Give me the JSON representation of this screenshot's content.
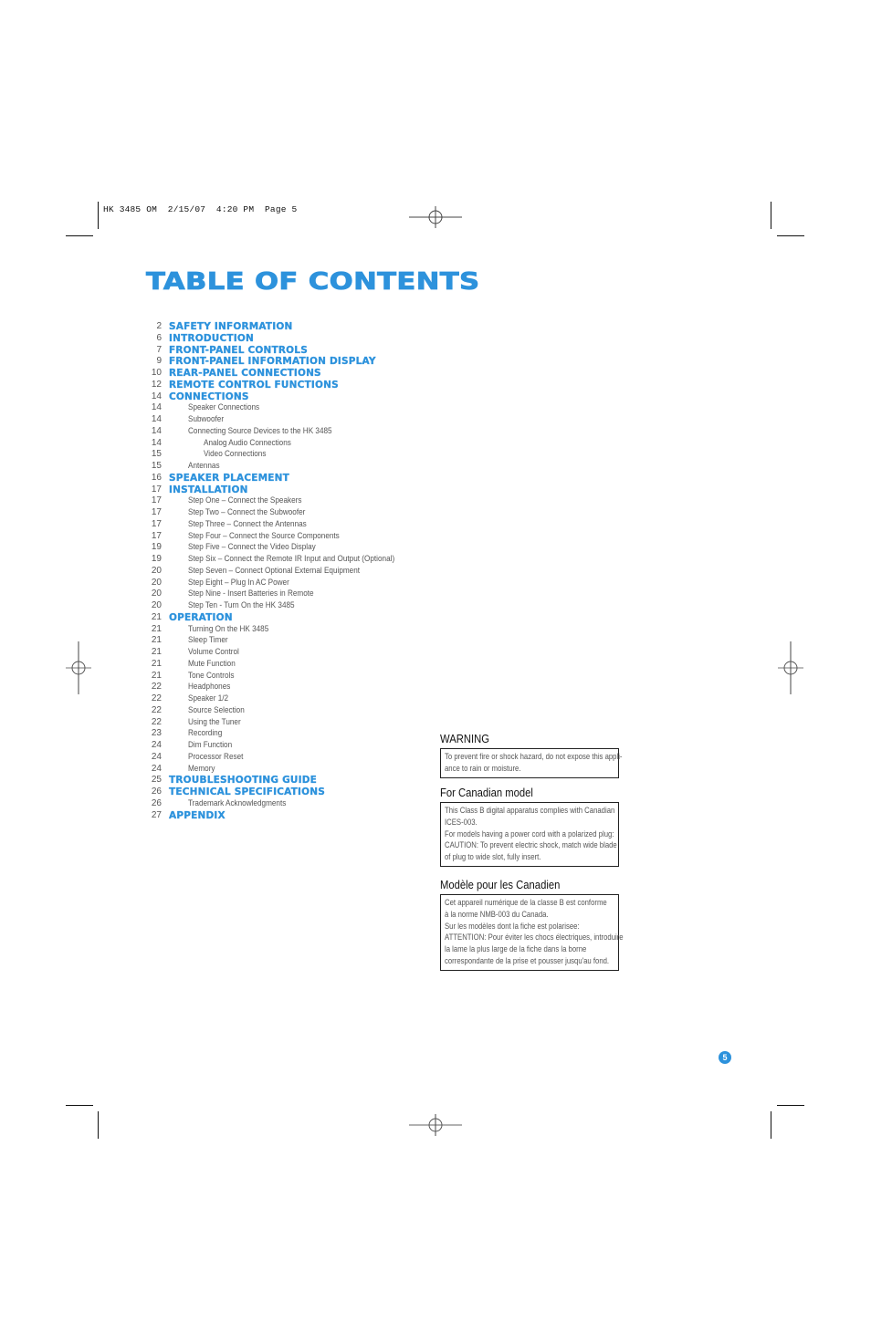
{
  "print_slug": "HK 3485 OM  2/15/07  4:20 PM  Page 5",
  "title": "TABLE OF CONTENTS",
  "accent_color": "#2d92dc",
  "toc": [
    {
      "page": "2",
      "label": "SAFETY INFORMATION",
      "level": 0
    },
    {
      "page": "6",
      "label": "INTRODUCTION",
      "level": 0
    },
    {
      "page": "7",
      "label": "FRONT-PANEL CONTROLS",
      "level": 0
    },
    {
      "page": "9",
      "label": "FRONT-PANEL INFORMATION DISPLAY",
      "level": 0
    },
    {
      "page": "10",
      "label": "REAR-PANEL CONNECTIONS",
      "level": 0
    },
    {
      "page": "12",
      "label": "REMOTE CONTROL FUNCTIONS",
      "level": 0
    },
    {
      "page": "14",
      "label": "CONNECTIONS",
      "level": 0
    },
    {
      "page": "14",
      "label": "Speaker Connections",
      "level": 1
    },
    {
      "page": "14",
      "label": "Subwoofer",
      "level": 1
    },
    {
      "page": "14",
      "label": "Connecting Source Devices to the HK 3485",
      "level": 1
    },
    {
      "page": "14",
      "label": "Analog Audio Connections",
      "level": 2
    },
    {
      "page": "15",
      "label": "Video Connections",
      "level": 2
    },
    {
      "page": "15",
      "label": "Antennas",
      "level": 1
    },
    {
      "page": "16",
      "label": "SPEAKER PLACEMENT",
      "level": 0
    },
    {
      "page": "17",
      "label": "INSTALLATION",
      "level": 0
    },
    {
      "page": "17",
      "label": "Step One – Connect the Speakers",
      "level": 1
    },
    {
      "page": "17",
      "label": "Step Two – Connect the Subwoofer",
      "level": 1
    },
    {
      "page": "17",
      "label": "Step Three – Connect the Antennas",
      "level": 1
    },
    {
      "page": "17",
      "label": "Step Four – Connect the Source Components",
      "level": 1
    },
    {
      "page": "19",
      "label": "Step Five – Connect the Video Display",
      "level": 1
    },
    {
      "page": "19",
      "label": "Step Six – Connect the Remote IR Input and Output (Optional)",
      "level": 1
    },
    {
      "page": "20",
      "label": "Step Seven – Connect Optional External Equipment",
      "level": 1
    },
    {
      "page": "20",
      "label": "Step Eight – Plug In AC Power",
      "level": 1
    },
    {
      "page": "20",
      "label": "Step Nine - Insert Batteries in Remote",
      "level": 1
    },
    {
      "page": "20",
      "label": "Step Ten - Turn On the HK 3485",
      "level": 1
    },
    {
      "page": "21",
      "label": "OPERATION",
      "level": 0
    },
    {
      "page": "21",
      "label": "Turning On the HK 3485",
      "level": 1
    },
    {
      "page": "21",
      "label": "Sleep Timer",
      "level": 1
    },
    {
      "page": "21",
      "label": "Volume Control",
      "level": 1
    },
    {
      "page": "21",
      "label": "Mute Function",
      "level": 1
    },
    {
      "page": "21",
      "label": "Tone Controls",
      "level": 1
    },
    {
      "page": "22",
      "label": "Headphones",
      "level": 1
    },
    {
      "page": "22",
      "label": "Speaker 1/2",
      "level": 1
    },
    {
      "page": "22",
      "label": "Source Selection",
      "level": 1
    },
    {
      "page": "22",
      "label": "Using the Tuner",
      "level": 1
    },
    {
      "page": "23",
      "label": "Recording",
      "level": 1
    },
    {
      "page": "24",
      "label": "Dim Function",
      "level": 1
    },
    {
      "page": "24",
      "label": "Processor Reset",
      "level": 1
    },
    {
      "page": "24",
      "label": "Memory",
      "level": 1
    },
    {
      "page": "25",
      "label": "TROUBLESHOOTING GUIDE",
      "level": 0
    },
    {
      "page": "26",
      "label": "TECHNICAL SPECIFICATIONS",
      "level": 0
    },
    {
      "page": "26",
      "label": "Trademark Acknowledgments",
      "level": 1
    },
    {
      "page": "27",
      "label": "APPENDIX",
      "level": 0
    }
  ],
  "notices": [
    {
      "heading": "WARNING",
      "lines": [
        "To prevent fire or shock hazard, do not expose this appli-",
        "ance to rain or moisture."
      ]
    },
    {
      "heading": "For Canadian model",
      "lines": [
        "This Class B digital apparatus complies with Canadian",
        "ICES-003.",
        "For models having a power cord with a polarized plug:",
        "CAUTION: To prevent electric shock, match wide blade",
        "of plug to wide slot, fully insert."
      ]
    },
    {
      "heading": "Modèle pour les Canadien",
      "lines": [
        "Cet appareil numérique de la classe B est conforme",
        "à la norme NMB-003 du Canada.",
        "Sur les modèles dont la fiche est polarisee:",
        "ATTENTION: Pour éviter les chocs électriques, introduire",
        "la lame la plus large de la fiche dans la borne",
        "correspondante de la prise et pousser jusqu'au fond."
      ]
    }
  ],
  "page_number": "5",
  "icons": {
    "registration_mark": "registration-mark-icon",
    "crop_mark": "crop-mark-icon"
  }
}
